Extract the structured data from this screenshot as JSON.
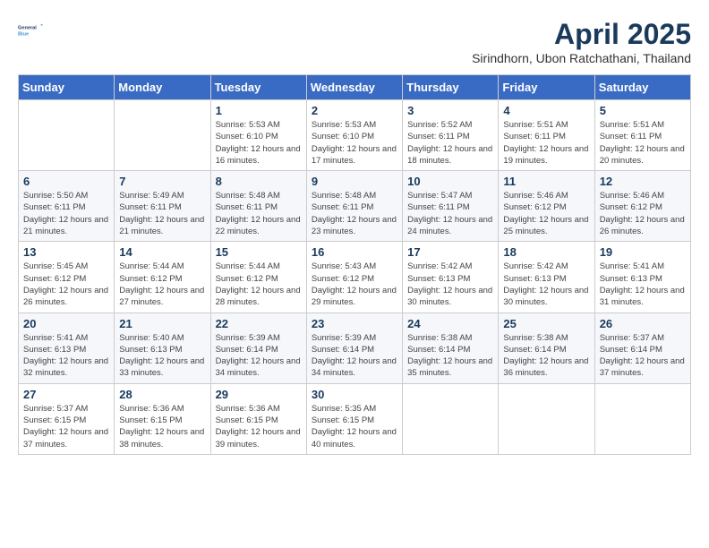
{
  "logo": {
    "line1": "General",
    "line2": "Blue"
  },
  "title": "April 2025",
  "subtitle": "Sirindhorn, Ubon Ratchathani, Thailand",
  "days_of_week": [
    "Sunday",
    "Monday",
    "Tuesday",
    "Wednesday",
    "Thursday",
    "Friday",
    "Saturday"
  ],
  "weeks": [
    [
      {
        "num": "",
        "info": ""
      },
      {
        "num": "",
        "info": ""
      },
      {
        "num": "1",
        "info": "Sunrise: 5:53 AM\nSunset: 6:10 PM\nDaylight: 12 hours and 16 minutes."
      },
      {
        "num": "2",
        "info": "Sunrise: 5:53 AM\nSunset: 6:10 PM\nDaylight: 12 hours and 17 minutes."
      },
      {
        "num": "3",
        "info": "Sunrise: 5:52 AM\nSunset: 6:11 PM\nDaylight: 12 hours and 18 minutes."
      },
      {
        "num": "4",
        "info": "Sunrise: 5:51 AM\nSunset: 6:11 PM\nDaylight: 12 hours and 19 minutes."
      },
      {
        "num": "5",
        "info": "Sunrise: 5:51 AM\nSunset: 6:11 PM\nDaylight: 12 hours and 20 minutes."
      }
    ],
    [
      {
        "num": "6",
        "info": "Sunrise: 5:50 AM\nSunset: 6:11 PM\nDaylight: 12 hours and 21 minutes."
      },
      {
        "num": "7",
        "info": "Sunrise: 5:49 AM\nSunset: 6:11 PM\nDaylight: 12 hours and 21 minutes."
      },
      {
        "num": "8",
        "info": "Sunrise: 5:48 AM\nSunset: 6:11 PM\nDaylight: 12 hours and 22 minutes."
      },
      {
        "num": "9",
        "info": "Sunrise: 5:48 AM\nSunset: 6:11 PM\nDaylight: 12 hours and 23 minutes."
      },
      {
        "num": "10",
        "info": "Sunrise: 5:47 AM\nSunset: 6:11 PM\nDaylight: 12 hours and 24 minutes."
      },
      {
        "num": "11",
        "info": "Sunrise: 5:46 AM\nSunset: 6:12 PM\nDaylight: 12 hours and 25 minutes."
      },
      {
        "num": "12",
        "info": "Sunrise: 5:46 AM\nSunset: 6:12 PM\nDaylight: 12 hours and 26 minutes."
      }
    ],
    [
      {
        "num": "13",
        "info": "Sunrise: 5:45 AM\nSunset: 6:12 PM\nDaylight: 12 hours and 26 minutes."
      },
      {
        "num": "14",
        "info": "Sunrise: 5:44 AM\nSunset: 6:12 PM\nDaylight: 12 hours and 27 minutes."
      },
      {
        "num": "15",
        "info": "Sunrise: 5:44 AM\nSunset: 6:12 PM\nDaylight: 12 hours and 28 minutes."
      },
      {
        "num": "16",
        "info": "Sunrise: 5:43 AM\nSunset: 6:12 PM\nDaylight: 12 hours and 29 minutes."
      },
      {
        "num": "17",
        "info": "Sunrise: 5:42 AM\nSunset: 6:13 PM\nDaylight: 12 hours and 30 minutes."
      },
      {
        "num": "18",
        "info": "Sunrise: 5:42 AM\nSunset: 6:13 PM\nDaylight: 12 hours and 30 minutes."
      },
      {
        "num": "19",
        "info": "Sunrise: 5:41 AM\nSunset: 6:13 PM\nDaylight: 12 hours and 31 minutes."
      }
    ],
    [
      {
        "num": "20",
        "info": "Sunrise: 5:41 AM\nSunset: 6:13 PM\nDaylight: 12 hours and 32 minutes."
      },
      {
        "num": "21",
        "info": "Sunrise: 5:40 AM\nSunset: 6:13 PM\nDaylight: 12 hours and 33 minutes."
      },
      {
        "num": "22",
        "info": "Sunrise: 5:39 AM\nSunset: 6:14 PM\nDaylight: 12 hours and 34 minutes."
      },
      {
        "num": "23",
        "info": "Sunrise: 5:39 AM\nSunset: 6:14 PM\nDaylight: 12 hours and 34 minutes."
      },
      {
        "num": "24",
        "info": "Sunrise: 5:38 AM\nSunset: 6:14 PM\nDaylight: 12 hours and 35 minutes."
      },
      {
        "num": "25",
        "info": "Sunrise: 5:38 AM\nSunset: 6:14 PM\nDaylight: 12 hours and 36 minutes."
      },
      {
        "num": "26",
        "info": "Sunrise: 5:37 AM\nSunset: 6:14 PM\nDaylight: 12 hours and 37 minutes."
      }
    ],
    [
      {
        "num": "27",
        "info": "Sunrise: 5:37 AM\nSunset: 6:15 PM\nDaylight: 12 hours and 37 minutes."
      },
      {
        "num": "28",
        "info": "Sunrise: 5:36 AM\nSunset: 6:15 PM\nDaylight: 12 hours and 38 minutes."
      },
      {
        "num": "29",
        "info": "Sunrise: 5:36 AM\nSunset: 6:15 PM\nDaylight: 12 hours and 39 minutes."
      },
      {
        "num": "30",
        "info": "Sunrise: 5:35 AM\nSunset: 6:15 PM\nDaylight: 12 hours and 40 minutes."
      },
      {
        "num": "",
        "info": ""
      },
      {
        "num": "",
        "info": ""
      },
      {
        "num": "",
        "info": ""
      }
    ]
  ]
}
